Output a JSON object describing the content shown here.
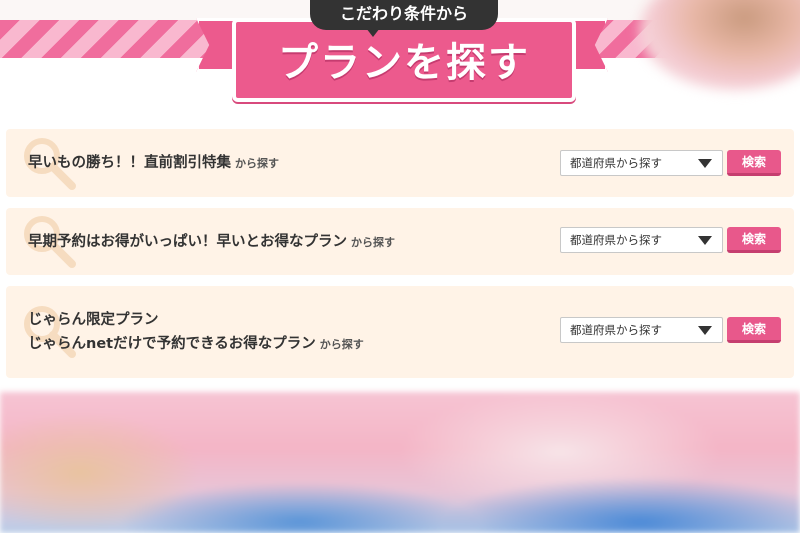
{
  "header": {
    "bubble_text": "こだわり条件から",
    "title": "プランを探す"
  },
  "rows": [
    {
      "lines": [
        "早いもの勝ち！！直前割引特集"
      ],
      "suffix": "から探す",
      "select_value": "都道府県から探す",
      "button_label": "検索"
    },
    {
      "lines": [
        "早期予約はお得がいっぱい！早いとお得なプラン"
      ],
      "suffix": "から探す",
      "select_value": "都道府県から探す",
      "button_label": "検索"
    },
    {
      "lines": [
        "じゃらん限定プラン",
        "じゃらんnetだけで予約できるお得なプラン"
      ],
      "suffix": "から探す",
      "select_value": "都道府県から探す",
      "button_label": "検索"
    }
  ],
  "colors": {
    "accent_pink": "#e8588b",
    "row_background": "#fff3e7",
    "magnifier": "#f6dcc0"
  },
  "icons": {
    "row_icon": "magnifier-icon",
    "select_icon": "chevron-down-icon"
  }
}
